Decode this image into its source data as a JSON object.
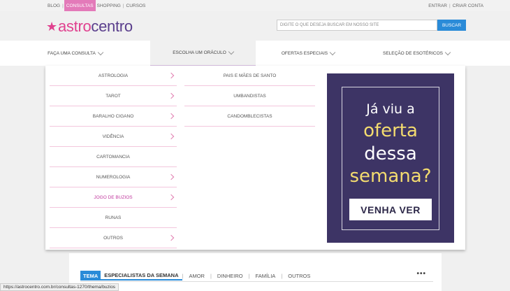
{
  "topbar": {
    "links": [
      "BLOG",
      "CONSULTAS",
      "SHOPPING",
      "CURSOS"
    ],
    "active_link": "CONSULTAS",
    "account": [
      "ENTRAR",
      "CRIAR CONTA"
    ]
  },
  "header": {
    "logo_a": "astro",
    "logo_b": "centro",
    "search_placeholder": "DIGITE O QUE DESEJA BUSCAR EM NOSSO SITE",
    "search_button": "BUSCAR"
  },
  "nav": [
    {
      "label": "FAÇA UMA CONSULTA"
    },
    {
      "label": "ESCOLHA UM ORÁCULO"
    },
    {
      "label": "OFERTAS ESPECIAIS"
    },
    {
      "label": "SELEÇÃO DE ESOTÉRICOS"
    }
  ],
  "dropdown": {
    "col1": [
      {
        "label": "ASTROLOGIA",
        "arrow": true
      },
      {
        "label": "TAROT",
        "arrow": true
      },
      {
        "label": "BARALHO CIGANO",
        "arrow": true
      },
      {
        "label": "VIDÊNCIA",
        "arrow": true
      },
      {
        "label": "CARTOMANCIA",
        "arrow": false
      },
      {
        "label": "NUMEROLOGIA",
        "arrow": true
      },
      {
        "label": "JOGO DE BUZIOS",
        "arrow": true,
        "highlight": true
      },
      {
        "label": "RUNAS",
        "arrow": false
      },
      {
        "label": "OUTROS",
        "arrow": true
      }
    ],
    "col2": [
      "PAIS E MÃES DE SANTO",
      "UMBANDISTAS",
      "CANDOMBLECISTAS"
    ],
    "banner": {
      "line1": "Já viu a",
      "line2": "oferta",
      "line3": "dessa",
      "line4": "semana?",
      "cta": "VENHA VER"
    }
  },
  "lower": {
    "tabs": [
      "TEMA",
      "ESPECIALISTAS DA SEMANA",
      "AMOR",
      "DINHEIRO",
      "FAMÍLIA",
      "OUTROS"
    ],
    "more": "•••"
  },
  "status_url": "https://astrocentro.com.br/consultas-1270/thema/buzios",
  "colors": {
    "pink": "#e0418f",
    "purple": "#5a3e8c",
    "blue": "#2a8bd8",
    "banner_bg": "#3d3465",
    "gold": "#f4dc6f"
  }
}
